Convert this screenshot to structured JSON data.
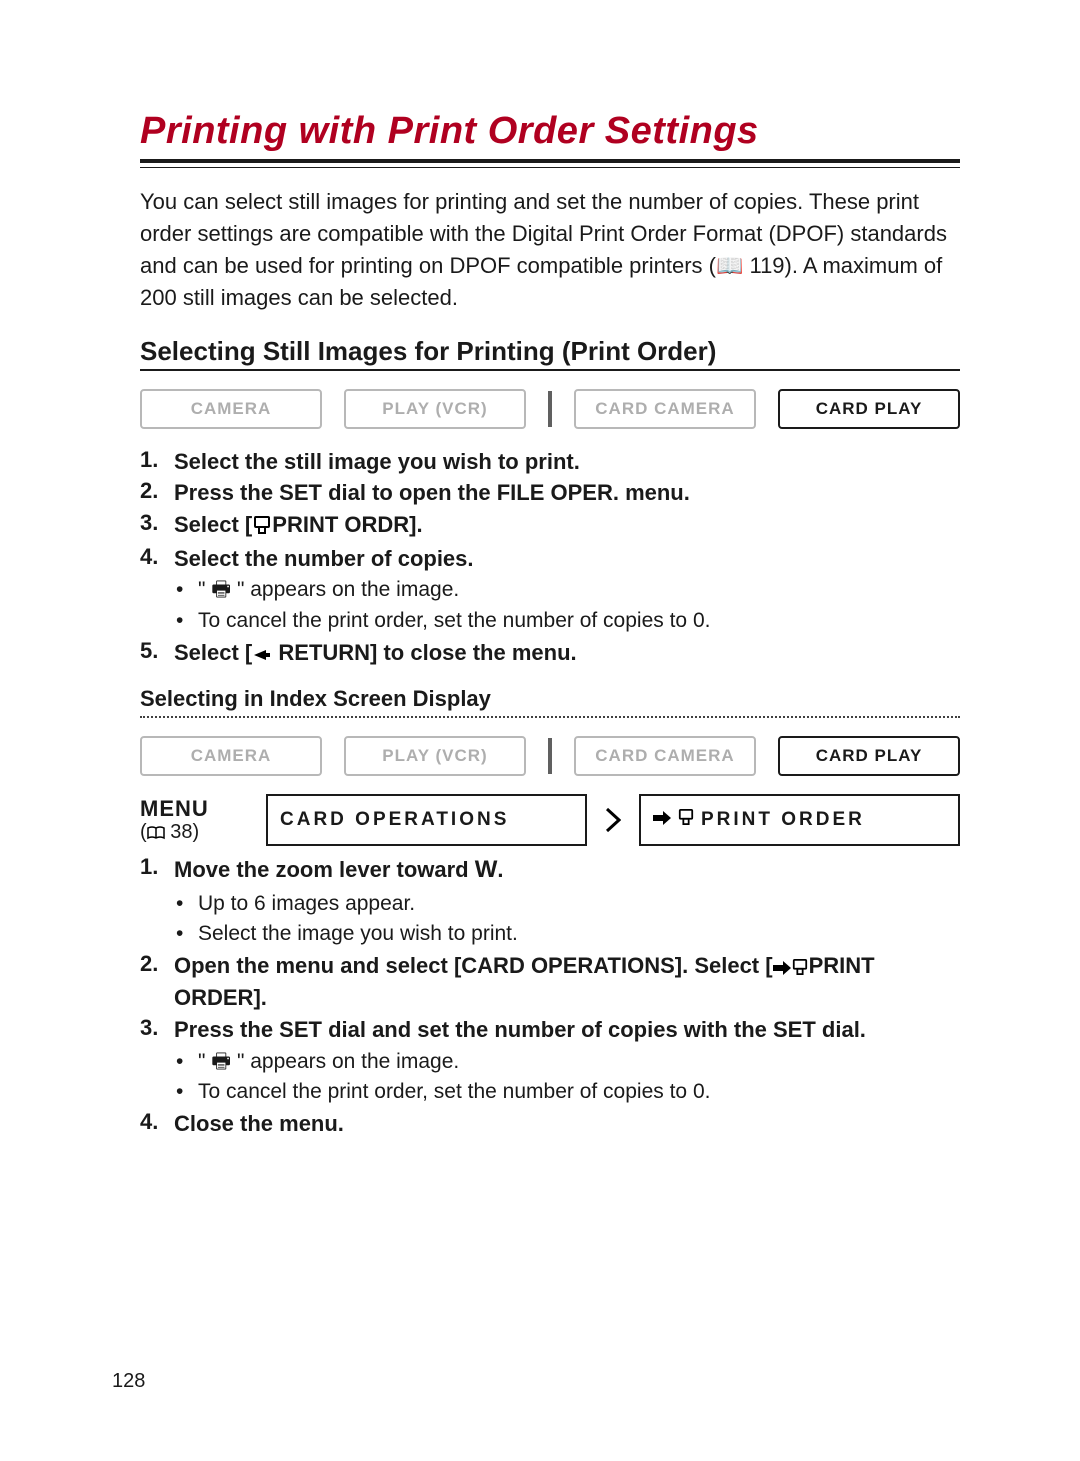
{
  "title": "Printing with Print Order Settings",
  "intro": "You can select still images for printing and set the number of copies. These print order settings are compatible with the Digital Print Order Format (DPOF) standards and can be used for printing on DPOF compatible printers (📖 119). A maximum of 200 still images can be selected.",
  "section1": {
    "heading": "Selecting Still Images for Printing (Print Order)",
    "modes": [
      "CAMERA",
      "PLAY (VCR)",
      "CARD CAMERA",
      "CARD PLAY"
    ],
    "mode_active_index": 3,
    "steps": {
      "s1": {
        "n": "1.",
        "t": "Select the still image you wish to print."
      },
      "s2": {
        "n": "2.",
        "t": "Press the SET dial to open the FILE OPER. menu."
      },
      "s3": {
        "n": "3.",
        "t_pre": "Select [",
        "t_post": "PRINT ORDR]."
      },
      "s4": {
        "n": "4.",
        "t": "Select the number of copies."
      },
      "s4_notes": [
        "\" 🖶 \" appears on the image.",
        "To cancel the print order, set the number of copies to 0."
      ],
      "s5": {
        "n": "5.",
        "t_pre": "Select [",
        "t_post": " RETURN] to close the menu."
      }
    }
  },
  "section2": {
    "heading": "Selecting in Index Screen Display",
    "modes": [
      "CAMERA",
      "PLAY (VCR)",
      "CARD CAMERA",
      "CARD PLAY"
    ],
    "mode_active_index": 3,
    "menu": {
      "label": "MENU",
      "ref_pre": "(",
      "ref_page": " 38)",
      "box1": "CARD OPERATIONS",
      "box2_post": "PRINT ORDER"
    },
    "steps": {
      "s1": {
        "n": "1.",
        "t_pre": "Move the zoom lever toward ",
        "t_w": "W",
        "t_post": "."
      },
      "s1_notes": [
        "Up to 6 images appear.",
        "Select the image you wish to print."
      ],
      "s2": {
        "n": "2.",
        "t_pre": "Open the menu and select [CARD OPERATIONS]. Select [",
        "t_post": "PRINT ORDER]."
      },
      "s3": {
        "n": "3.",
        "t": "Press the SET dial and set the number of copies with the SET dial."
      },
      "s3_notes": [
        "\" 🖶 \" appears on the image.",
        "To cancel the print order, set the number of copies to 0."
      ],
      "s4": {
        "n": "4.",
        "t": "Close the menu."
      }
    }
  },
  "page_number": "128"
}
